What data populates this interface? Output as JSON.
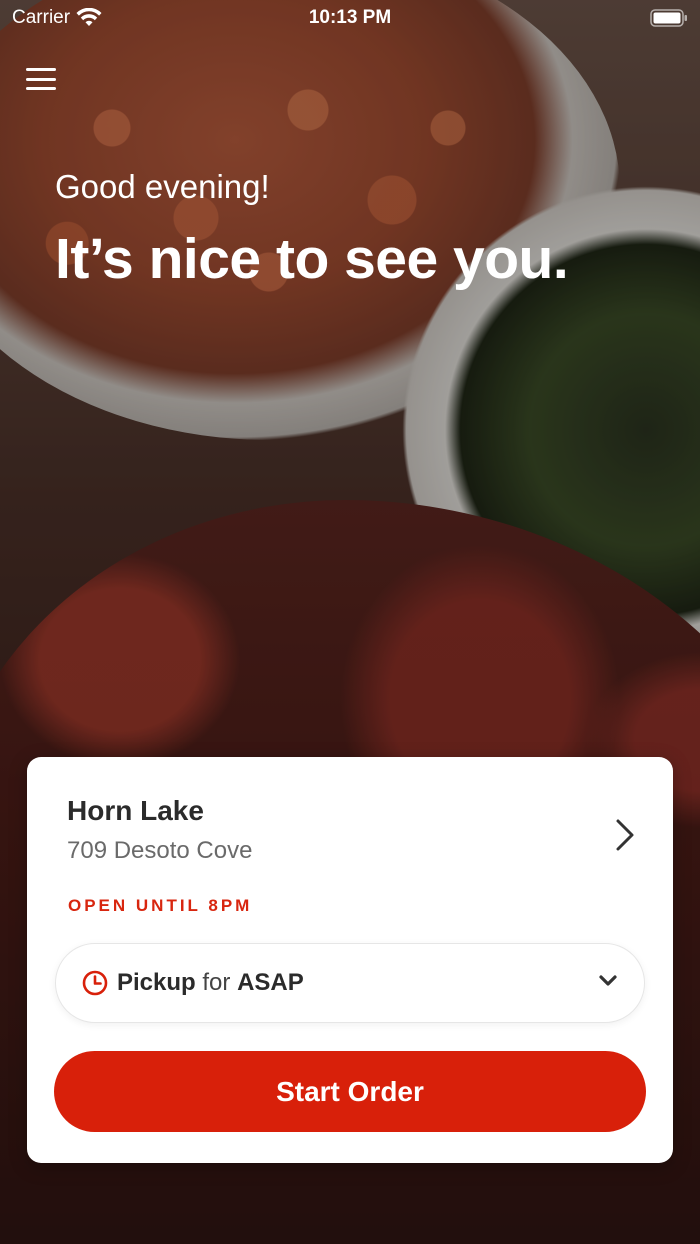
{
  "status_bar": {
    "carrier": "Carrier",
    "time": "10:13 PM"
  },
  "header": {
    "menu_icon": "hamburger-menu-icon",
    "greeting": "Good evening!",
    "headline": "It’s nice to see you."
  },
  "store": {
    "name": "Horn Lake",
    "address": "709 Desoto Cove",
    "hours": "OPEN UNTIL 8PM",
    "chevron_icon": "chevron-right-icon"
  },
  "order": {
    "type": "Pickup",
    "connector": "for",
    "time": "ASAP",
    "clock_icon": "clock-icon",
    "dropdown_icon": "chevron-down-icon"
  },
  "actions": {
    "start_order": "Start Order"
  },
  "colors": {
    "accent": "#d8200a",
    "hours_text": "#d8260f",
    "card_bg": "#ffffff"
  }
}
